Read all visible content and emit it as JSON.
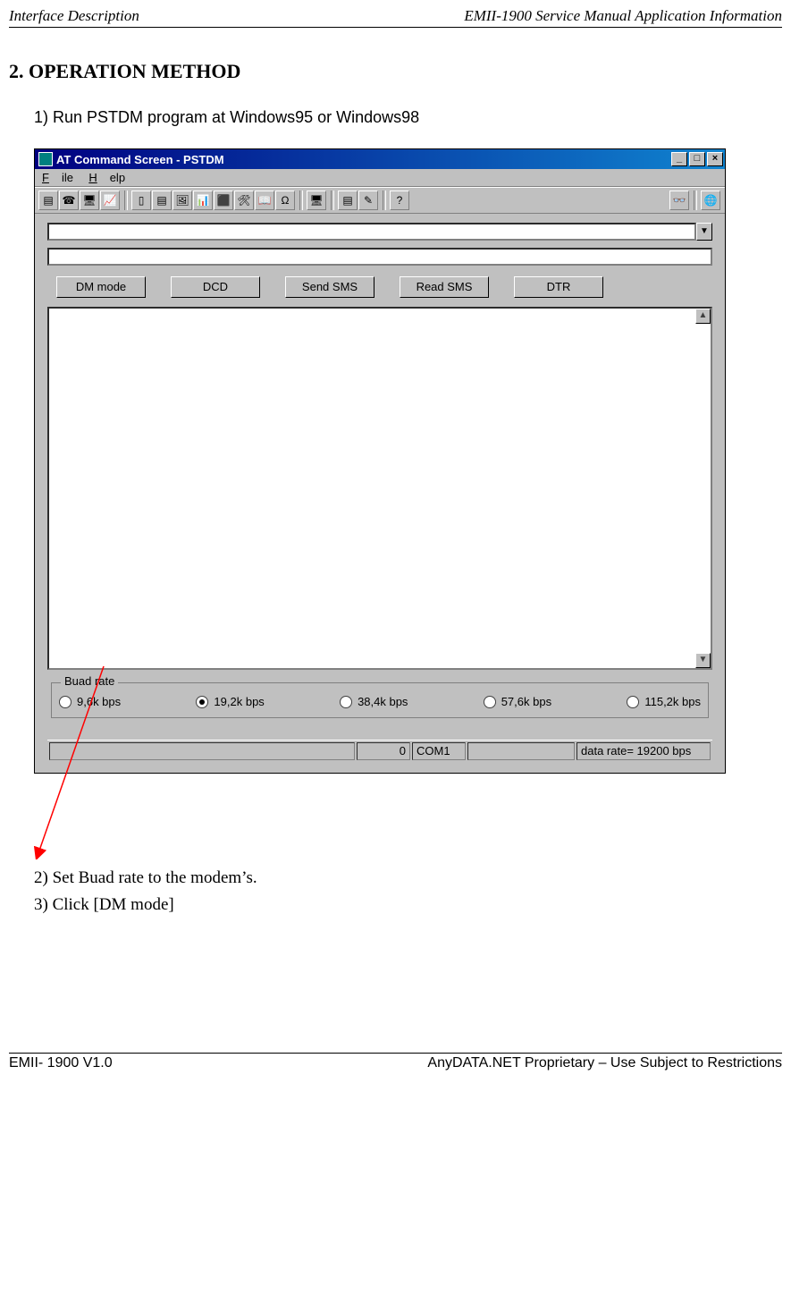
{
  "doc_header": {
    "left": "Interface Description",
    "right": "EMII-1900 Service Manual Application Information"
  },
  "section_title": "2. OPERATION METHOD",
  "step1": "1) Run PSTDM program at Windows95 or Windows98",
  "step2": "2) Set Buad rate to the modem’s.",
  "step3": "3) Click [DM mode]",
  "window": {
    "title": "AT Command Screen - PSTDM",
    "minimize": "_",
    "maximize": "□",
    "close": "×",
    "menu": {
      "file": "File",
      "file_ul": "F",
      "help": "Help",
      "help_ul": "H"
    },
    "buttons": {
      "dm": "DM mode",
      "dcd": "DCD",
      "send": "Send SMS",
      "read": "Read SMS",
      "dtr": "DTR"
    },
    "baud": {
      "legend": "Buad rate",
      "options": [
        {
          "label": "9,6k bps",
          "selected": false
        },
        {
          "label": "19,2k bps",
          "selected": true
        },
        {
          "label": "38,4k bps",
          "selected": false
        },
        {
          "label": "57,6k bps",
          "selected": false
        },
        {
          "label": "115,2k bps",
          "selected": false
        }
      ]
    },
    "status": {
      "count": "0",
      "port": "COM1",
      "rate": "data rate= 19200 bps"
    }
  },
  "doc_footer": {
    "left": "EMII- 1900 V1.0",
    "right": "AnyDATA.NET Proprietary –  Use Subject to Restrictions"
  }
}
